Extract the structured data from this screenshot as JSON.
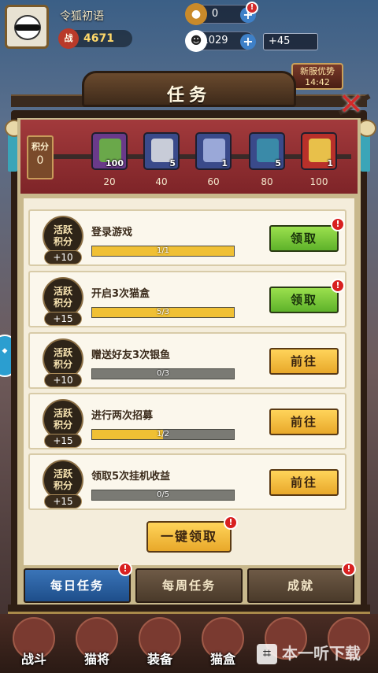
{
  "hud": {
    "nickname": "令狐初语",
    "power_badge": "战",
    "power": "4671",
    "coin_icon": "coin-icon",
    "coins": "0",
    "fish_icon": "cat-head-icon",
    "fish": "1029",
    "fish_gain": "+45",
    "event_banner": "新服优势\n14:42",
    "alert_glyph": "!"
  },
  "panel": {
    "title": "任务",
    "close_icon": "close-x-icon"
  },
  "score": {
    "label": "积分",
    "value": "0",
    "chests": [
      {
        "icon": "talisman-icon",
        "count": "100",
        "points": "20",
        "color": "#6a3a8a",
        "art": "#6aa84a"
      },
      {
        "icon": "fish-icon",
        "count": "5",
        "points": "40",
        "color": "#3a4a8a",
        "art": "#c8ccd8"
      },
      {
        "icon": "treasure-chest-icon",
        "count": "1",
        "points": "60",
        "color": "#3a4a8a",
        "art": "#9aa8d8"
      },
      {
        "icon": "scroll-book-icon",
        "count": "5",
        "points": "80",
        "color": "#3a4a8a",
        "art": "#3a8aa8"
      },
      {
        "icon": "golden-token-icon",
        "count": "1",
        "points": "100",
        "color": "#b8302a",
        "art": "#e8c04a"
      }
    ]
  },
  "tasks": [
    {
      "medal_text": "活跃\n积分",
      "points": "+10",
      "name": "登录游戏",
      "progress_text": "1/1",
      "progress": 1.0,
      "button": "领取",
      "style": "green",
      "alert": true
    },
    {
      "medal_text": "活跃\n积分",
      "points": "+15",
      "name": "开启3次猫盒",
      "progress_text": "5/3",
      "progress": 1.0,
      "button": "领取",
      "style": "green",
      "alert": true
    },
    {
      "medal_text": "活跃\n积分",
      "points": "+10",
      "name": "赠送好友3次银鱼",
      "progress_text": "0/3",
      "progress": 0.0,
      "button": "前往",
      "style": "yellow",
      "alert": false
    },
    {
      "medal_text": "活跃\n积分",
      "points": "+15",
      "name": "进行两次招募",
      "progress_text": "1/2",
      "progress": 0.5,
      "button": "前往",
      "style": "yellow",
      "alert": false
    },
    {
      "medal_text": "活跃\n积分",
      "points": "+15",
      "name": "领取5次挂机收益",
      "progress_text": "0/5",
      "progress": 0.0,
      "button": "前往",
      "style": "yellow",
      "alert": false
    }
  ],
  "claim_all": "一键领取",
  "tabs": [
    {
      "label": "每日任务",
      "active": true,
      "alert": true
    },
    {
      "label": "每周任务",
      "active": false,
      "alert": false
    },
    {
      "label": "成就",
      "active": false,
      "alert": true
    }
  ],
  "bottom_nav": [
    {
      "label": "战斗",
      "icon": "battle-icon"
    },
    {
      "label": "猫将",
      "icon": "cat-general-icon"
    },
    {
      "label": "装备",
      "icon": "equipment-icon"
    },
    {
      "label": "猫盒",
      "icon": "cat-box-icon"
    },
    {
      "label": "",
      "icon": "more-icon"
    },
    {
      "label": "",
      "icon": "more-icon"
    }
  ],
  "watermark": "本一听下载",
  "colors": {
    "accent_green": "#5eb22a",
    "accent_yellow": "#e8a82a",
    "tab_active": "#1e4e8a",
    "alert_red": "#d82020"
  }
}
